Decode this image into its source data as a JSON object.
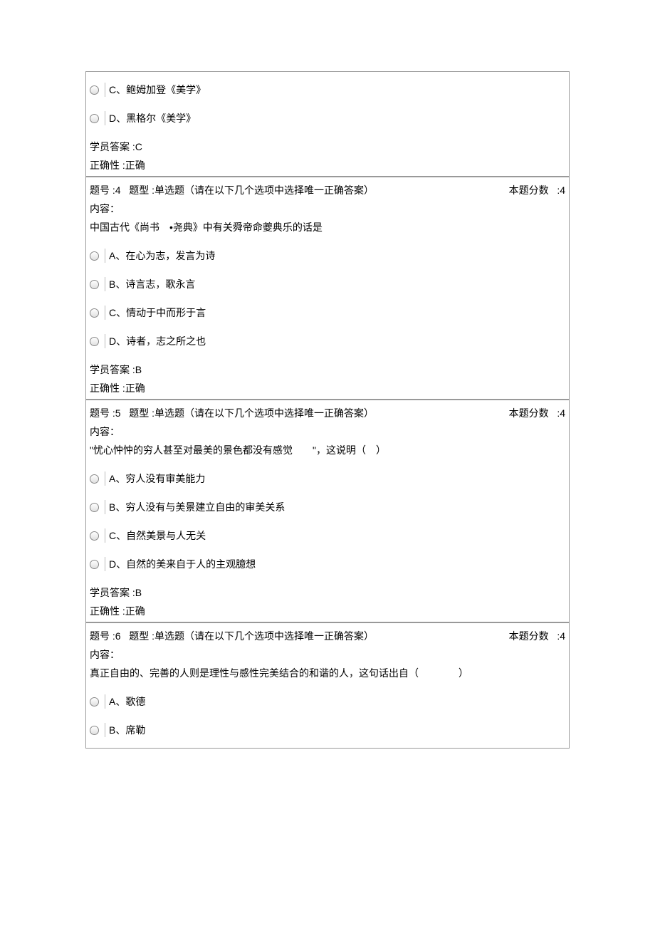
{
  "partial_question": {
    "options": [
      {
        "letter": "C",
        "text": "、鲍姆加登《美学》"
      },
      {
        "letter": "D",
        "text": "、黑格尔《美学》"
      }
    ],
    "student_answer_label": "学员答案",
    "student_answer_value": ":C",
    "correctness_label": "正确性",
    "correctness_value": ":正确"
  },
  "questions": [
    {
      "number_label": "题号 :4",
      "type_label": "题型 :单选题（请在以下几个选项中选择唯一正确答案）",
      "score_label": "本题分数",
      "score_value": ":4",
      "content_label": "内容：",
      "question_text": "中国古代《尚书　•尧典》中有关舜帝命夔典乐的话是",
      "options": [
        {
          "letter": "A",
          "text": "、在心为志，发言为诗"
        },
        {
          "letter": "B",
          "text": "、诗言志，歌永言"
        },
        {
          "letter": "C",
          "text": "、情动于中而形于言"
        },
        {
          "letter": "D",
          "text": "、诗者，志之所之也"
        }
      ],
      "student_answer_label": "学员答案",
      "student_answer_value": ":B",
      "correctness_label": "正确性",
      "correctness_value": ":正确"
    },
    {
      "number_label": "题号 :5",
      "type_label": "题型 :单选题（请在以下几个选项中选择唯一正确答案）",
      "score_label": "本题分数",
      "score_value": ":4",
      "content_label": "内容：",
      "question_text": "\"忧心忡忡的穷人甚至对最美的景色都没有感觉　　\"，这说明（　）",
      "options": [
        {
          "letter": "A",
          "text": "、穷人没有审美能力"
        },
        {
          "letter": "B",
          "text": "、穷人没有与美景建立自由的审美关系"
        },
        {
          "letter": "C",
          "text": "、自然美景与人无关"
        },
        {
          "letter": "D",
          "text": "、自然的美来自于人的主观臆想"
        }
      ],
      "student_answer_label": "学员答案",
      "student_answer_value": ":B",
      "correctness_label": "正确性",
      "correctness_value": ":正确"
    },
    {
      "number_label": "题号 :6",
      "type_label": "题型 :单选题（请在以下几个选项中选择唯一正确答案）",
      "score_label": "本题分数",
      "score_value": ":4",
      "content_label": "内容：",
      "question_text": "真正自由的、完善的人则是理性与感性完美结合的和谐的人，这句话出自（　　　　）",
      "options": [
        {
          "letter": "A",
          "text": "、歌德"
        },
        {
          "letter": "B",
          "text": "、席勒"
        }
      ],
      "student_answer_label": "",
      "student_answer_value": "",
      "correctness_label": "",
      "correctness_value": ""
    }
  ]
}
